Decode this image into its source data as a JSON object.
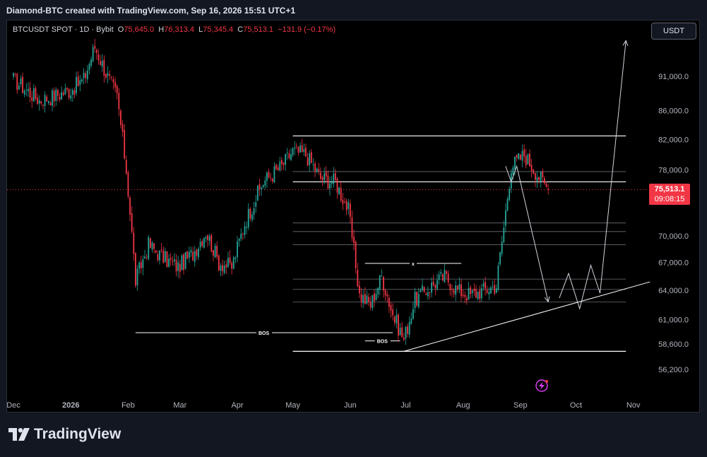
{
  "header": {
    "title": "Diamond-BTC created with TradingView.com, Sep 16, 2026 15:51 UTC+1"
  },
  "legend": {
    "symbol": "BTCUSDT SPOT · 1D · Bybit",
    "o_label": "O",
    "o_value": "75,645.0",
    "h_label": "H",
    "h_value": "76,313.4",
    "l_label": "L",
    "l_value": "75,345.4",
    "c_label": "C",
    "c_value": "75,513.1",
    "change": "−131.9 (−0.17%)"
  },
  "currency_button": "USDT",
  "price_tag": {
    "price": "75,513.1",
    "countdown": "09:08:15"
  },
  "footer": {
    "brand": "TradingView"
  },
  "colors": {
    "up": "#26a69a",
    "down": "#f23645",
    "background": "#000000",
    "line": "#ffffff"
  },
  "icons": [
    "lightning-icon",
    "tradingview-logo-icon"
  ],
  "chart_data": {
    "type": "candlestick",
    "y_axis": {
      "scale": "log",
      "ticks": [
        91000,
        86000,
        82000,
        78000,
        70000,
        67000,
        64000,
        61000,
        58600,
        56200
      ],
      "tick_labels": [
        "91,000.0",
        "86,000.0",
        "82,000.0",
        "78,000.0",
        "70,000.0",
        "67,000.0",
        "64,000.0",
        "61,000.0",
        "58,600.0",
        "56,200.0"
      ]
    },
    "x_axis": {
      "labels": [
        "Dec",
        "2026",
        "Feb",
        "Mar",
        "Apr",
        "May",
        "Jun",
        "Jul",
        "Aug",
        "Sep",
        "Oct",
        "Nov"
      ]
    },
    "last_price": 75513.1,
    "waypoints": [
      [
        "2025-12-01",
        90500
      ],
      [
        "2025-12-08",
        89000
      ],
      [
        "2025-12-15",
        87500
      ],
      [
        "2025-12-22",
        88000
      ],
      [
        "2026-01-01",
        89000
      ],
      [
        "2026-01-08",
        90500
      ],
      [
        "2026-01-14",
        95500
      ],
      [
        "2026-01-20",
        91500
      ],
      [
        "2026-01-26",
        88000
      ],
      [
        "2026-01-31",
        78000
      ],
      [
        "2026-02-05",
        65000
      ],
      [
        "2026-02-12",
        69000
      ],
      [
        "2026-02-20",
        67500
      ],
      [
        "2026-02-28",
        66500
      ],
      [
        "2026-03-08",
        68000
      ],
      [
        "2026-03-15",
        70500
      ],
      [
        "2026-03-22",
        67000
      ],
      [
        "2026-03-29",
        66500
      ],
      [
        "2026-04-05",
        71500
      ],
      [
        "2026-04-15",
        76500
      ],
      [
        "2026-04-25",
        78500
      ],
      [
        "2026-05-01",
        80500
      ],
      [
        "2026-05-08",
        80000
      ],
      [
        "2026-05-16",
        77000
      ],
      [
        "2026-05-24",
        76500
      ],
      [
        "2026-05-31",
        73000
      ],
      [
        "2026-06-06",
        63500
      ],
      [
        "2026-06-12",
        62500
      ],
      [
        "2026-06-18",
        65500
      ],
      [
        "2026-06-24",
        61500
      ],
      [
        "2026-06-30",
        59000
      ],
      [
        "2026-07-06",
        63000
      ],
      [
        "2026-07-15",
        64500
      ],
      [
        "2026-07-22",
        65500
      ],
      [
        "2026-07-29",
        64000
      ],
      [
        "2026-08-05",
        63500
      ],
      [
        "2026-08-12",
        64000
      ],
      [
        "2026-08-19",
        64500
      ],
      [
        "2026-08-23",
        71000
      ],
      [
        "2026-08-27",
        78500
      ],
      [
        "2026-09-03",
        80000
      ],
      [
        "2026-09-10",
        77500
      ],
      [
        "2026-09-16",
        75513.1
      ]
    ],
    "levels": [
      {
        "price": 82500,
        "from": "2026-05-01",
        "to": "2026-10-28"
      },
      {
        "price": 76500,
        "from": "2026-05-01",
        "to": "2026-10-28"
      },
      {
        "price": 77800,
        "from": "2026-05-01",
        "to": "2026-10-28"
      },
      {
        "price": 71500,
        "from": "2026-05-01",
        "to": "2026-10-28"
      },
      {
        "price": 70500,
        "from": "2026-05-01",
        "to": "2026-10-28"
      },
      {
        "price": 69000,
        "from": "2026-05-01",
        "to": "2026-10-28"
      },
      {
        "price": 65200,
        "from": "2026-05-01",
        "to": "2026-10-28"
      },
      {
        "price": 64100,
        "from": "2026-05-01",
        "to": "2026-10-28"
      },
      {
        "price": 62800,
        "from": "2026-05-01",
        "to": "2026-10-28"
      },
      {
        "price": 57900,
        "from": "2026-05-01",
        "to": "2026-10-28"
      }
    ],
    "annotations": [
      {
        "type": "hline",
        "label": "BOS",
        "price": 59700,
        "from": "2026-02-05",
        "to": "2026-06-24"
      },
      {
        "type": "hline",
        "label": "BOS",
        "price": 58900,
        "from": "2026-06-09",
        "to": "2026-06-28"
      },
      {
        "type": "hline",
        "label": "x",
        "price": 66900,
        "from": "2026-06-09",
        "to": "2026-07-31"
      }
    ],
    "trendline": {
      "from": [
        "2026-06-30",
        57900
      ],
      "to": [
        "2026-11-10",
        64900
      ]
    },
    "projection": [
      [
        "2026-08-24",
        78500
      ],
      [
        "2026-08-27",
        76500
      ],
      [
        "2026-08-30",
        78500
      ],
      [
        "2026-09-16",
        62800
      ],
      [
        "2026-09-22",
        63200
      ],
      [
        "2026-09-27",
        65800
      ],
      [
        "2026-10-03",
        62100
      ],
      [
        "2026-10-09",
        66700
      ],
      [
        "2026-10-14",
        63700
      ],
      [
        "2026-10-28",
        96500
      ]
    ],
    "grid": false,
    "legend_position": "top-left"
  }
}
